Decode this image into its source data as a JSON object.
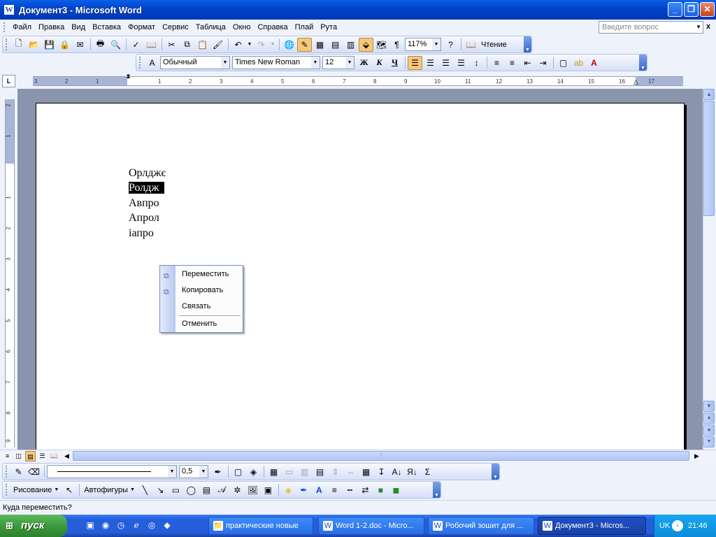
{
  "window": {
    "title": "Документ3 - Microsoft Word"
  },
  "menu": {
    "items": [
      "Файл",
      "Правка",
      "Вид",
      "Вставка",
      "Формат",
      "Сервис",
      "Таблица",
      "Окно",
      "Справка",
      "Плай",
      "Рута"
    ],
    "help_placeholder": "Введите вопрос",
    "close_glyph": "x"
  },
  "standard_toolbar": {
    "zoom": "117%",
    "reading_label": "Чтение"
  },
  "formatting_toolbar": {
    "style": "Обычный",
    "font": "Times New Roman",
    "size": "12",
    "bold_label": "Ж",
    "italic_label": "К",
    "underline_label": "Ч"
  },
  "rulers": {
    "horizontal_numbers": [
      "3",
      "2",
      "1",
      "1",
      "2",
      "3",
      "4",
      "5",
      "6",
      "7",
      "8",
      "9",
      "10",
      "11",
      "12",
      "13",
      "14",
      "15",
      "16",
      "17"
    ],
    "vertical_numbers": [
      "2",
      "1",
      "1",
      "2",
      "3",
      "4",
      "5",
      "6",
      "7",
      "8",
      "9"
    ]
  },
  "document": {
    "lines": [
      "Орлджє",
      "Ролдж",
      "Авпро",
      "Апрол",
      "іапро"
    ],
    "selected_line_index": 1
  },
  "context_menu": {
    "items": [
      {
        "label": "Переместить",
        "icon": "copy-paste-icon"
      },
      {
        "label": "Копировать",
        "icon": "copy-icon"
      },
      {
        "label": "Связать",
        "icon": ""
      },
      {
        "label": "Отменить",
        "icon": ""
      }
    ]
  },
  "drawing_toolbar": {
    "line_width": "0,5",
    "draw_label": "Рисование",
    "autoshapes_label": "Автофигуры",
    "sigma": "Σ"
  },
  "status": {
    "text": "Куда переместить?"
  },
  "taskbar": {
    "start_label": "пуск",
    "tasks": [
      "практические новые",
      "Word 1-2.doc - Micro...",
      "Робочий зошит для ...",
      "Документ3 - Micros..."
    ],
    "active_task_index": 3,
    "language": "UK",
    "time": "21:46"
  },
  "colors": {
    "titlebar": "#0a5fe8",
    "taskbar": "#245edb",
    "start": "#3c9a3c",
    "highlight": "#f7c87a"
  }
}
